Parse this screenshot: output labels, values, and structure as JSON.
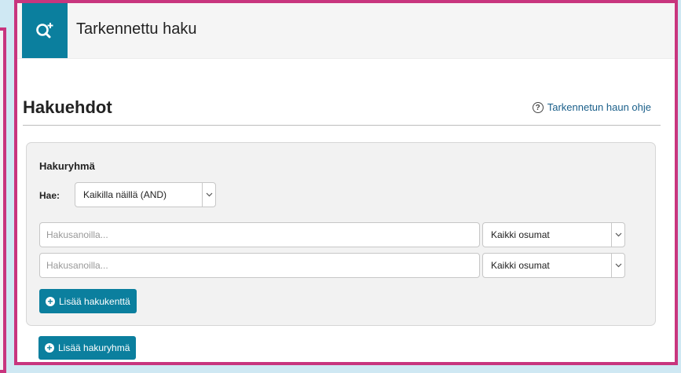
{
  "header": {
    "title": "Tarkennettu haku",
    "icon": "advanced-search-icon"
  },
  "section": {
    "title": "Hakuehdot",
    "help_link": "Tarkennetun haun ohje"
  },
  "group": {
    "title": "Hakuryhmä",
    "match_label": "Hae:",
    "match_value": "Kaikilla näillä (AND)",
    "rows": [
      {
        "placeholder": "Hakusanoilla...",
        "field": "Kaikki osumat"
      },
      {
        "placeholder": "Hakusanoilla...",
        "field": "Kaikki osumat"
      }
    ],
    "add_field_label": "Lisää hakukenttä"
  },
  "add_group_label": "Lisää hakuryhmä",
  "colors": {
    "accent": "#0b7f9e",
    "frame": "#c8357e"
  }
}
